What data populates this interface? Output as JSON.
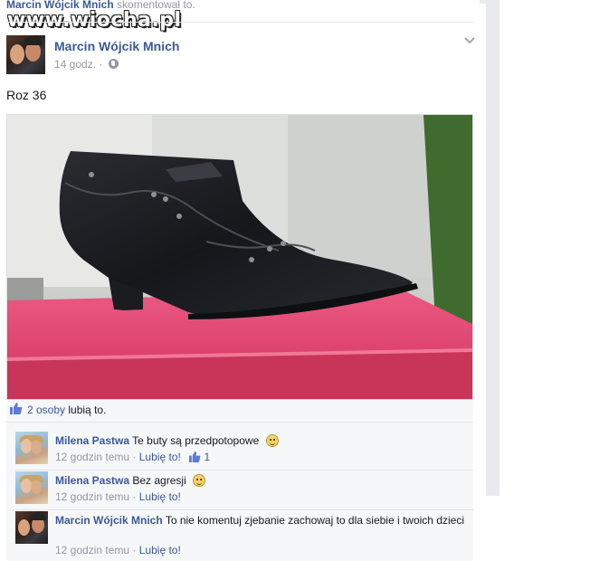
{
  "watermark": "www.wiocha.pl",
  "previous_activity": {
    "name": "Marcin Wójcik Mnich",
    "action": "skomentował to."
  },
  "post": {
    "author": "Marcin Wójcik Mnich",
    "time": "14 godz.",
    "separator": "·",
    "privacy_icon": "globe-icon",
    "text": "Roz 36",
    "photo_subject": "black-ankle-boot-on-pink-box"
  },
  "likes": {
    "count_label": "2 osoby",
    "suffix": "lubią to."
  },
  "comments": [
    {
      "author": "Milena Pastwa",
      "text": "Te buty są przedpotopowe",
      "emoji": "smile-emoji",
      "time": "12 godzin temu",
      "separator": "·",
      "like_label": "Lubię to!",
      "like_count": "1"
    },
    {
      "author": "Milena Pastwa",
      "text": "Bez agresji",
      "emoji": "grimace-emoji",
      "time": "12 godzin temu",
      "separator": "·",
      "like_label": "Lubię to!"
    },
    {
      "author": "Marcin Wójcik Mnich",
      "text": "To nie komentuj zjebanie zachowaj to dla siebie i twoich dzieci",
      "time": "12 godzin temu",
      "separator": "·",
      "like_label": "Lubię to!"
    }
  ],
  "colors": {
    "link": "#3b5998",
    "meta": "#9197a3",
    "panel": "#f6f7f8",
    "box_pink": "#e0456e"
  }
}
